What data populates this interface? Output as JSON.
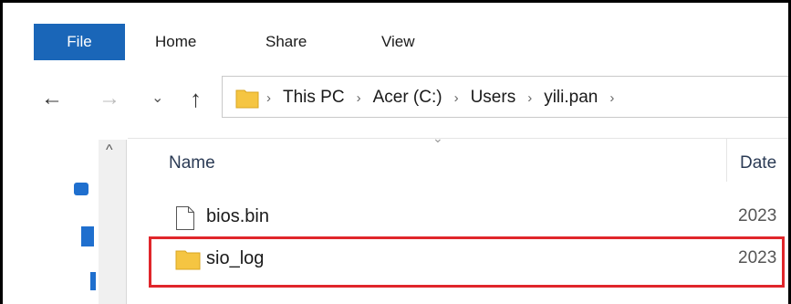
{
  "ribbon": {
    "tabs": [
      {
        "label": "File",
        "active": true
      },
      {
        "label": "Home"
      },
      {
        "label": "Share"
      },
      {
        "label": "View"
      }
    ]
  },
  "nav": {
    "back_glyph": "←",
    "forward_glyph": "→",
    "recent_glyph": "⌄",
    "up_glyph": "↑"
  },
  "address": {
    "crumbs": [
      "This PC",
      "Acer (C:)",
      "Users",
      "yili.pan"
    ],
    "separator": "›"
  },
  "columns": {
    "name": "Name",
    "date": "Date"
  },
  "files": [
    {
      "name": "bios.bin",
      "type": "file",
      "date": "2023"
    },
    {
      "name": "sio_log",
      "type": "folder",
      "date": "2023"
    }
  ],
  "colors": {
    "file_tab": "#1a66b8",
    "highlight": "#e0262b",
    "folder": "#f5c542"
  }
}
